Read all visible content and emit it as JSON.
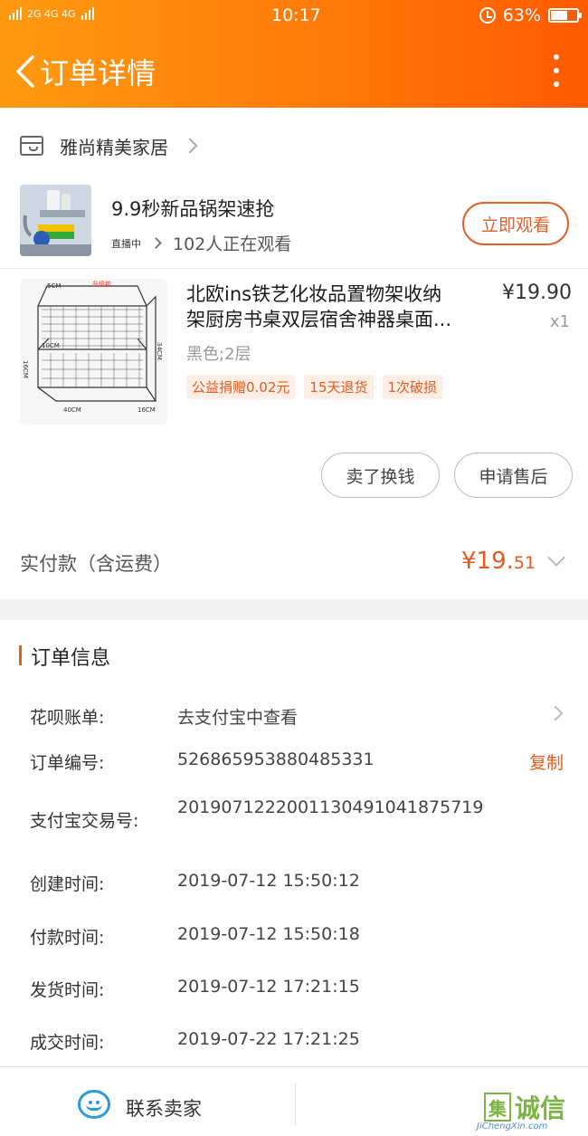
{
  "status_bar": {
    "network": "2G 4G 4G",
    "time": "10:17",
    "battery": "63%",
    "battery_level": 0.63
  },
  "nav": {
    "title": "订单详情"
  },
  "shop": {
    "name": "雅尚精美家居"
  },
  "live": {
    "title": "9.9秒新品锅架速抢",
    "badge": "直播中",
    "viewers": "102人正在观看",
    "button": "立即观看"
  },
  "product": {
    "title_line1": "北欧ins铁艺化妆品置物架收纳",
    "title_line2": "架厨房书桌双层宿舍神器桌面...",
    "price": "¥19.90",
    "quantity": "x1",
    "sku": "黑色;2层",
    "tags": [
      "公益捐赠0.02元",
      "15天退货",
      "1次破损"
    ],
    "image_labels": {
      "width_top": "5CM",
      "badge": "升级款",
      "height": "34CM",
      "side": "16CM",
      "mid": "10CM",
      "bottom": "40CM",
      "depth": "16CM"
    }
  },
  "actions": {
    "sell": "卖了换钱",
    "after_sale": "申请售后"
  },
  "payment": {
    "label": "实付款（含运费）",
    "amount_main": "¥19.",
    "amount_cents": "51"
  },
  "order_info": {
    "title": "订单信息",
    "rows": [
      {
        "label": "花呗账单:",
        "value": "去支付宝中查看"
      },
      {
        "label": "订单编号:",
        "value": "526865953880485331"
      },
      {
        "label": "支付宝交易号:",
        "value": "2019071222001130491041875719"
      },
      {
        "label": "创建时间:",
        "value": "2019-07-12 15:50:12"
      },
      {
        "label": "付款时间:",
        "value": "2019-07-12 15:50:18"
      },
      {
        "label": "发货时间:",
        "value": "2019-07-12 17:21:15"
      },
      {
        "label": "成交时间:",
        "value": "2019-07-22 17:21:25"
      }
    ],
    "copy": "复制"
  },
  "bottom_bar": {
    "contact": "联系卖家"
  },
  "watermark": {
    "mark": "集",
    "text": "诚信",
    "sub": "JiChengXin.com"
  },
  "colors": {
    "accent": "#e85a1c",
    "header_start": "#ff9a10",
    "header_end": "#ff5a00",
    "contact_blue": "#2c9ad8"
  }
}
